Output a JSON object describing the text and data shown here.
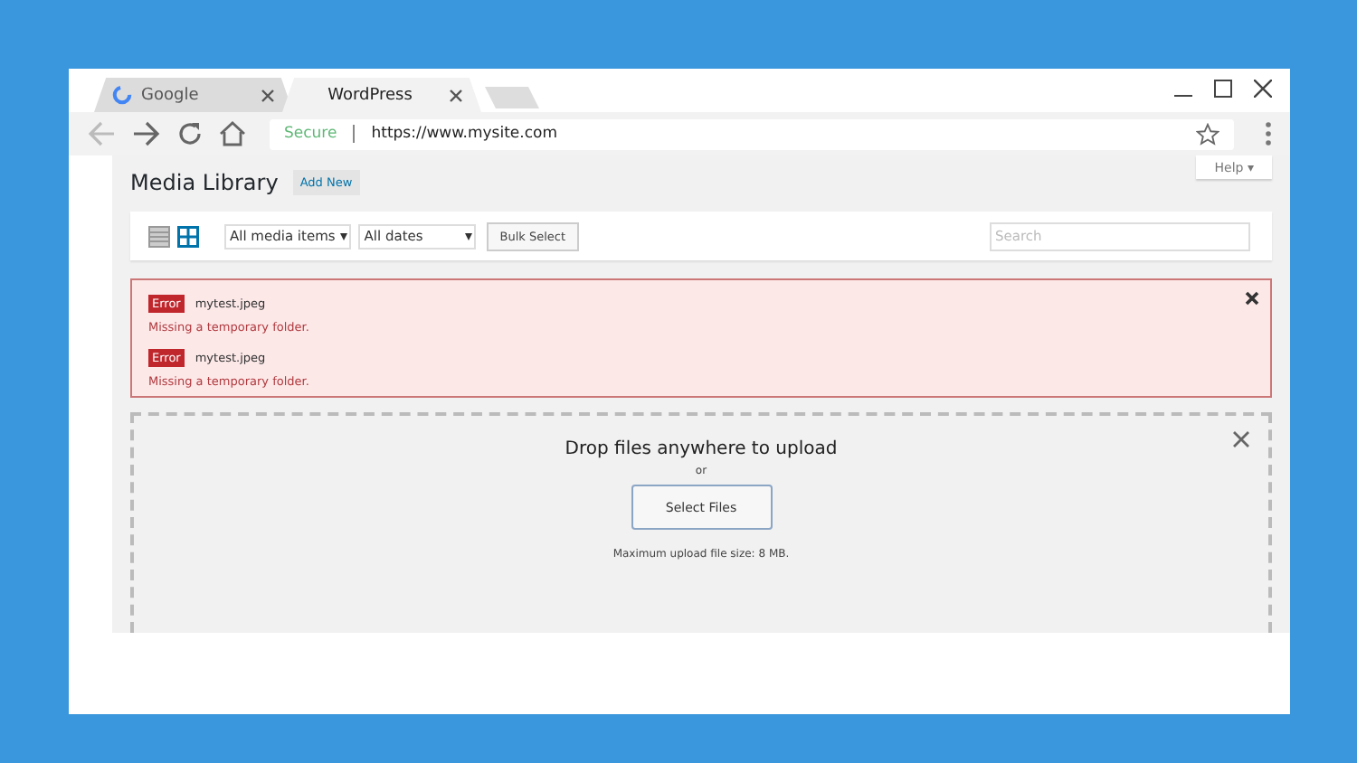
{
  "browser": {
    "tabs": [
      {
        "label": "Google",
        "selected": false
      },
      {
        "label": "WordPress",
        "selected": true
      }
    ],
    "secure_label": "Secure",
    "url": "https://www.mysite.com"
  },
  "help_button": "Help ▾",
  "page_title": "Media Library",
  "add_new": "Add New",
  "view_modes": [
    {
      "kind": "list",
      "selected": false
    },
    {
      "kind": "grid",
      "selected": true
    }
  ],
  "filters": [
    {
      "value": "All media items"
    },
    {
      "value": "All dates"
    }
  ],
  "bulk_select": "Bulk Select",
  "search": {
    "placeholder": "Search"
  },
  "errors": [
    {
      "badge": "Error",
      "file": "mytest.jpeg",
      "message": "Missing a temporary folder."
    },
    {
      "badge": "Error",
      "file": "mytest.jpeg",
      "message": "Missing a temporary folder."
    }
  ],
  "uploader": {
    "heading": "Drop files anywhere to upload",
    "or": "or",
    "button": "Select Files",
    "note": "Maximum upload file size: 8 MB."
  }
}
